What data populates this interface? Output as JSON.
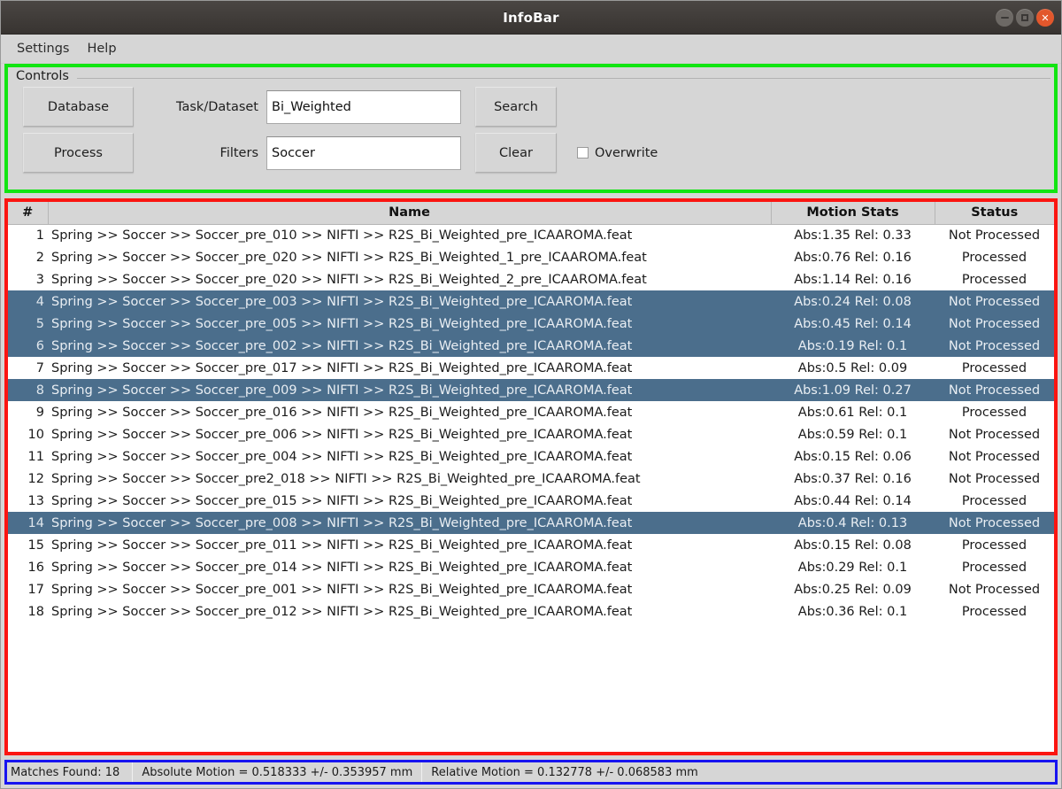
{
  "window": {
    "title": "InfoBar",
    "buttons": {
      "minimize": "minimize-icon",
      "maximize": "maximize-icon",
      "close": "✕"
    }
  },
  "menubar": {
    "items": [
      {
        "label": "Settings"
      },
      {
        "label": "Help"
      }
    ]
  },
  "controls": {
    "group_label": "Controls",
    "database_button": "Database",
    "process_button": "Process",
    "task_label": "Task/Dataset",
    "task_value": "Bi_Weighted",
    "task_placeholder": "",
    "filters_label": "Filters",
    "filters_value": "Soccer",
    "filters_placeholder": "",
    "search_button": "Search",
    "clear_button": "Clear",
    "overwrite_label": "Overwrite",
    "overwrite_checked": false,
    "border_color": "#12e512"
  },
  "table": {
    "border_color": "#fb1511",
    "selection_color": "#4b6e8c",
    "columns": [
      "#",
      "Name",
      "Motion Stats",
      "Status"
    ],
    "rows": [
      {
        "num": "1",
        "name": "Spring >> Soccer >> Soccer_pre_010 >> NIFTI >> R2S_Bi_Weighted_pre_ICAAROMA.feat",
        "motion": "Abs:1.35 Rel: 0.33",
        "status": "Not Processed",
        "selected": false
      },
      {
        "num": "2",
        "name": "Spring >> Soccer >> Soccer_pre_020 >> NIFTI >> R2S_Bi_Weighted_1_pre_ICAAROMA.feat",
        "motion": "Abs:0.76 Rel: 0.16",
        "status": "Processed",
        "selected": false
      },
      {
        "num": "3",
        "name": "Spring >> Soccer >> Soccer_pre_020 >> NIFTI >> R2S_Bi_Weighted_2_pre_ICAAROMA.feat",
        "motion": "Abs:1.14 Rel: 0.16",
        "status": "Processed",
        "selected": false
      },
      {
        "num": "4",
        "name": "Spring >> Soccer >> Soccer_pre_003 >> NIFTI >> R2S_Bi_Weighted_pre_ICAAROMA.feat",
        "motion": "Abs:0.24 Rel: 0.08",
        "status": "Not Processed",
        "selected": true
      },
      {
        "num": "5",
        "name": "Spring >> Soccer >> Soccer_pre_005 >> NIFTI >> R2S_Bi_Weighted_pre_ICAAROMA.feat",
        "motion": "Abs:0.45 Rel: 0.14",
        "status": "Not Processed",
        "selected": true
      },
      {
        "num": "6",
        "name": "Spring >> Soccer >> Soccer_pre_002 >> NIFTI >> R2S_Bi_Weighted_pre_ICAAROMA.feat",
        "motion": "Abs:0.19 Rel: 0.1",
        "status": "Not Processed",
        "selected": true
      },
      {
        "num": "7",
        "name": "Spring >> Soccer >> Soccer_pre_017 >> NIFTI >> R2S_Bi_Weighted_pre_ICAAROMA.feat",
        "motion": "Abs:0.5 Rel: 0.09",
        "status": "Processed",
        "selected": false
      },
      {
        "num": "8",
        "name": "Spring >> Soccer >> Soccer_pre_009 >> NIFTI >> R2S_Bi_Weighted_pre_ICAAROMA.feat",
        "motion": "Abs:1.09 Rel: 0.27",
        "status": "Not Processed",
        "selected": true
      },
      {
        "num": "9",
        "name": "Spring >> Soccer >> Soccer_pre_016 >> NIFTI >> R2S_Bi_Weighted_pre_ICAAROMA.feat",
        "motion": "Abs:0.61 Rel: 0.1",
        "status": "Processed",
        "selected": false
      },
      {
        "num": "10",
        "name": "Spring >> Soccer >> Soccer_pre_006 >> NIFTI >> R2S_Bi_Weighted_pre_ICAAROMA.feat",
        "motion": "Abs:0.59 Rel: 0.1",
        "status": "Not Processed",
        "selected": false
      },
      {
        "num": "11",
        "name": "Spring >> Soccer >> Soccer_pre_004 >> NIFTI >> R2S_Bi_Weighted_pre_ICAAROMA.feat",
        "motion": "Abs:0.15 Rel: 0.06",
        "status": "Not Processed",
        "selected": false
      },
      {
        "num": "12",
        "name": "Spring >> Soccer >> Soccer_pre2_018 >> NIFTI >> R2S_Bi_Weighted_pre_ICAAROMA.feat",
        "motion": "Abs:0.37 Rel: 0.16",
        "status": "Not Processed",
        "selected": false
      },
      {
        "num": "13",
        "name": "Spring >> Soccer >> Soccer_pre_015 >> NIFTI >> R2S_Bi_Weighted_pre_ICAAROMA.feat",
        "motion": "Abs:0.44 Rel: 0.14",
        "status": "Processed",
        "selected": false
      },
      {
        "num": "14",
        "name": "Spring >> Soccer >> Soccer_pre_008 >> NIFTI >> R2S_Bi_Weighted_pre_ICAAROMA.feat",
        "motion": "Abs:0.4 Rel: 0.13",
        "status": "Not Processed",
        "selected": true
      },
      {
        "num": "15",
        "name": "Spring >> Soccer >> Soccer_pre_011 >> NIFTI >> R2S_Bi_Weighted_pre_ICAAROMA.feat",
        "motion": "Abs:0.15 Rel: 0.08",
        "status": "Processed",
        "selected": false
      },
      {
        "num": "16",
        "name": "Spring >> Soccer >> Soccer_pre_014 >> NIFTI >> R2S_Bi_Weighted_pre_ICAAROMA.feat",
        "motion": "Abs:0.29 Rel: 0.1",
        "status": "Processed",
        "selected": false
      },
      {
        "num": "17",
        "name": "Spring >> Soccer >> Soccer_pre_001 >> NIFTI >> R2S_Bi_Weighted_pre_ICAAROMA.feat",
        "motion": "Abs:0.25 Rel: 0.09",
        "status": "Not Processed",
        "selected": false
      },
      {
        "num": "18",
        "name": "Spring >> Soccer >> Soccer_pre_012 >> NIFTI >> R2S_Bi_Weighted_pre_ICAAROMA.feat",
        "motion": "Abs:0.36 Rel: 0.1",
        "status": "Processed",
        "selected": false
      }
    ]
  },
  "statusbar": {
    "border_color": "#1714f0",
    "matches": "Matches Found: 18",
    "separator": "|",
    "absolute_motion": "Absolute Motion = 0.518333 +/- 0.353957 mm",
    "relative_motion": "Relative Motion = 0.132778  +/- 0.068583 mm"
  }
}
